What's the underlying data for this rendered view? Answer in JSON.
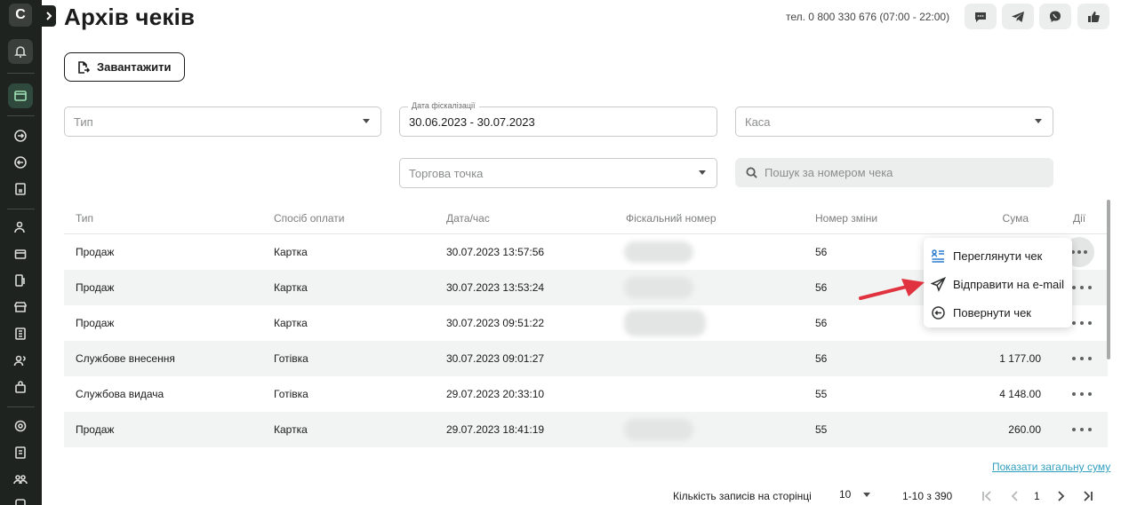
{
  "app": {
    "logo_letter": "C"
  },
  "header": {
    "title": "Архів чеків",
    "phone": "тел. 0 800 330 676 (07:00 - 22:00)"
  },
  "toolbar": {
    "download_label": "Завантажити"
  },
  "filters": {
    "type": {
      "placeholder": "Тип"
    },
    "fiscal_date": {
      "label": "Дата фіскалізації",
      "value": "30.06.2023 - 30.07.2023"
    },
    "cashbox": {
      "placeholder": "Каса"
    },
    "outlet": {
      "placeholder": "Торгова точка"
    },
    "search": {
      "placeholder": "Пошук за номером чека"
    }
  },
  "table": {
    "columns": [
      "Тип",
      "Спосіб оплати",
      "Дата/час",
      "Фіскальний номер",
      "Номер зміни",
      "Сума",
      "Дії"
    ],
    "rows": [
      {
        "type": "Продаж",
        "payment": "Картка",
        "datetime": "30.07.2023 13:57:56",
        "fiscal_blurred": true,
        "shift": "56",
        "sum": ""
      },
      {
        "type": "Продаж",
        "payment": "Картка",
        "datetime": "30.07.2023 13:53:24",
        "fiscal_blurred": true,
        "shift": "56",
        "sum": ""
      },
      {
        "type": "Продаж",
        "payment": "Картка",
        "datetime": "30.07.2023 09:51:22",
        "fiscal_blurred": true,
        "shift": "56",
        "sum": ""
      },
      {
        "type": "Службове внесення",
        "payment": "Готівка",
        "datetime": "30.07.2023 09:01:27",
        "fiscal_blurred": false,
        "shift": "56",
        "sum": "1 177.00"
      },
      {
        "type": "Службова видача",
        "payment": "Готівка",
        "datetime": "29.07.2023 20:33:10",
        "fiscal_blurred": false,
        "shift": "55",
        "sum": "4 148.00"
      },
      {
        "type": "Продаж",
        "payment": "Картка",
        "datetime": "29.07.2023 18:41:19",
        "fiscal_blurred": true,
        "shift": "55",
        "sum": "260.00"
      }
    ]
  },
  "context_menu": {
    "items": [
      {
        "label": "Переглянути чек",
        "icon": "receipt-view-icon"
      },
      {
        "label": "Відправити на e-mail",
        "icon": "send-icon"
      },
      {
        "label": "Повернути чек",
        "icon": "return-icon"
      }
    ]
  },
  "footer": {
    "show_total_link": "Показати загальну суму",
    "rows_per_page_label": "Кількість записів на сторінці",
    "rows_per_page_value": "10",
    "range": "1-10 з 390",
    "current_page": "1"
  },
  "colors": {
    "sidebar": "#1e2320",
    "accent_link": "#2f9fbf",
    "annotation_arrow": "#e0323f"
  }
}
